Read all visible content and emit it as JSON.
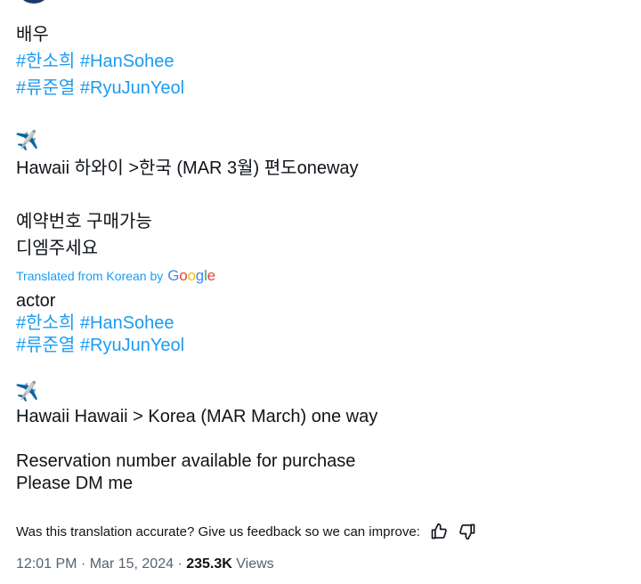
{
  "header": {
    "handle_partial": "@ · ······"
  },
  "original": {
    "line1": "배우",
    "line2_tags": [
      "#한소희",
      "#HanSohee"
    ],
    "line3_tags": [
      "#류준열",
      "#RyuJunYeol"
    ],
    "plane": "✈️",
    "route": "Hawaii 하와이 >한국 (MAR 3월) 편도oneway",
    "reserve": "예약번호 구매가능",
    "dm": "디엠주세요"
  },
  "translation_bar": {
    "label": "Translated from Korean by",
    "google": "Google"
  },
  "translated": {
    "line1": "actor",
    "line2_tags": [
      "#한소희",
      "#HanSohee"
    ],
    "line3_tags": [
      "#류준열",
      "#RyuJunYeol"
    ],
    "plane": "✈️",
    "route": "Hawaii Hawaii > Korea (MAR March) one way",
    "reserve": "Reservation number available for purchase",
    "dm": "Please DM me"
  },
  "feedback": {
    "question": "Was this translation accurate? Give us feedback so we can improve:",
    "thumbs_up_icon": "thumbs-up-icon",
    "thumbs_down_icon": "thumbs-down-icon"
  },
  "meta": {
    "time": "12:01 PM",
    "sep": "·",
    "date": "Mar 15, 2024",
    "views_count": "235.3K",
    "views_label": "Views"
  }
}
